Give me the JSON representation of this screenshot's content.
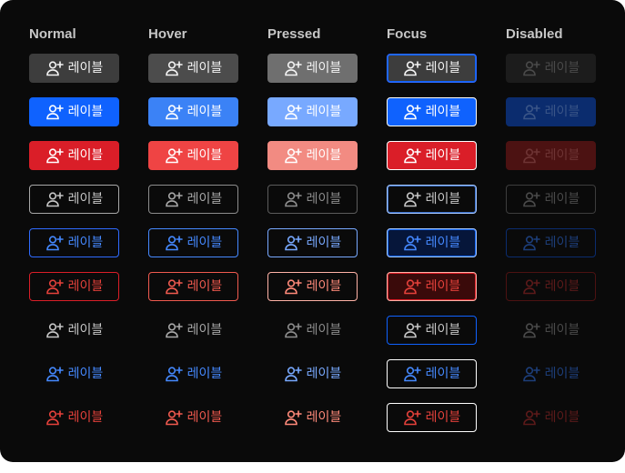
{
  "columns": [
    "Normal",
    "Hover",
    "Pressed",
    "Focus",
    "Disabled"
  ],
  "button_label": "레이블",
  "icon": "user-plus-icon",
  "rows": [
    {
      "name": "secondary",
      "states": [
        {
          "bg": "#3d3d3d",
          "border": "#3d3d3d",
          "fg": "#f4f4f4"
        },
        {
          "bg": "#4c4c4c",
          "border": "#4c4c4c",
          "fg": "#f4f4f4"
        },
        {
          "bg": "#6f6f6f",
          "border": "#6f6f6f",
          "fg": "#f4f4f4"
        },
        {
          "bg": "#3d3d3d",
          "border": "#2f6bff",
          "fg": "#f4f4f4",
          "ring": "#0f62fe"
        },
        {
          "bg": "#1c1c1c",
          "border": "#1c1c1c",
          "fg": "#4a4a4a"
        }
      ]
    },
    {
      "name": "primary",
      "states": [
        {
          "bg": "#0f62fe",
          "border": "#0f62fe",
          "fg": "#ffffff"
        },
        {
          "bg": "#3b82f6",
          "border": "#3b82f6",
          "fg": "#ffffff"
        },
        {
          "bg": "#78a9ff",
          "border": "#78a9ff",
          "fg": "#ffffff"
        },
        {
          "bg": "#0f62fe",
          "border": "#ffffff",
          "fg": "#ffffff"
        },
        {
          "bg": "#0b2c6e",
          "border": "#0b2c6e",
          "fg": "#3a5587"
        }
      ]
    },
    {
      "name": "danger",
      "states": [
        {
          "bg": "#da1e28",
          "border": "#da1e28",
          "fg": "#ffffff"
        },
        {
          "bg": "#ef4444",
          "border": "#ef4444",
          "fg": "#ffffff"
        },
        {
          "bg": "#f28b82",
          "border": "#f28b82",
          "fg": "#ffffff"
        },
        {
          "bg": "#da1e28",
          "border": "#ffffff",
          "fg": "#ffffff"
        },
        {
          "bg": "#4c1212",
          "border": "#4c1212",
          "fg": "#6e3434"
        }
      ]
    },
    {
      "name": "tertiary",
      "states": [
        {
          "bg": "transparent",
          "border": "#a8a8a8",
          "fg": "#c6c6c6"
        },
        {
          "bg": "transparent",
          "border": "#8d8d8d",
          "fg": "#a8a8a8"
        },
        {
          "bg": "transparent",
          "border": "#5c5c5c",
          "fg": "#8d8d8d"
        },
        {
          "bg": "transparent",
          "border": "#a6c8ff",
          "fg": "#c6c6c6",
          "ring": "#3a6ec9"
        },
        {
          "bg": "transparent",
          "border": "#3d3d3d",
          "fg": "#4a4a4a"
        }
      ]
    },
    {
      "name": "tertiary-primary",
      "states": [
        {
          "bg": "transparent",
          "border": "#2f6bff",
          "fg": "#4589ff"
        },
        {
          "bg": "transparent",
          "border": "#4589ff",
          "fg": "#4589ff"
        },
        {
          "bg": "transparent",
          "border": "#78a9ff",
          "fg": "#78a9ff"
        },
        {
          "bg": "#06163a",
          "border": "#a6c8ff",
          "fg": "#4589ff",
          "ring": "#0f62fe"
        },
        {
          "bg": "transparent",
          "border": "#0b2c6e",
          "fg": "#1d3e7a"
        }
      ]
    },
    {
      "name": "tertiary-danger",
      "states": [
        {
          "bg": "transparent",
          "border": "#da1e28",
          "fg": "#e5413b"
        },
        {
          "bg": "transparent",
          "border": "#f05a4f",
          "fg": "#f05a4f"
        },
        {
          "bg": "transparent",
          "border": "#ffb3a7",
          "fg": "#ff8a7a"
        },
        {
          "bg": "#3a0a0a",
          "border": "#ffb3a7",
          "fg": "#e5413b",
          "ring": "#da1e28"
        },
        {
          "bg": "transparent",
          "border": "#4c1212",
          "fg": "#5c1a1a"
        }
      ]
    },
    {
      "name": "ghost",
      "states": [
        {
          "bg": "transparent",
          "border": "transparent",
          "fg": "#c6c6c6"
        },
        {
          "bg": "transparent",
          "border": "transparent",
          "fg": "#a8a8a8"
        },
        {
          "bg": "transparent",
          "border": "transparent",
          "fg": "#8d8d8d"
        },
        {
          "bg": "transparent",
          "border": "#0f62fe",
          "fg": "#c6c6c6"
        },
        {
          "bg": "transparent",
          "border": "transparent",
          "fg": "#4a4a4a"
        }
      ]
    },
    {
      "name": "ghost-primary",
      "states": [
        {
          "bg": "transparent",
          "border": "transparent",
          "fg": "#4589ff"
        },
        {
          "bg": "transparent",
          "border": "transparent",
          "fg": "#4589ff"
        },
        {
          "bg": "transparent",
          "border": "transparent",
          "fg": "#78a9ff"
        },
        {
          "bg": "transparent",
          "border": "#ffffff",
          "fg": "#4589ff"
        },
        {
          "bg": "transparent",
          "border": "transparent",
          "fg": "#1d3e7a"
        }
      ]
    },
    {
      "name": "ghost-danger",
      "states": [
        {
          "bg": "transparent",
          "border": "transparent",
          "fg": "#e5413b"
        },
        {
          "bg": "transparent",
          "border": "transparent",
          "fg": "#f05a4f"
        },
        {
          "bg": "transparent",
          "border": "transparent",
          "fg": "#ff8a7a"
        },
        {
          "bg": "transparent",
          "border": "#ffffff",
          "fg": "#e5413b"
        },
        {
          "bg": "transparent",
          "border": "transparent",
          "fg": "#5c1a1a"
        }
      ]
    }
  ]
}
